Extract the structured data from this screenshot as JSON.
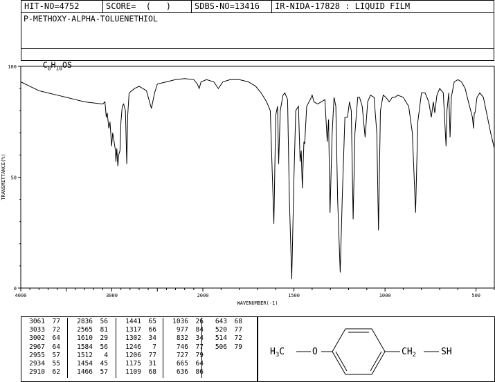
{
  "header": {
    "hit_no": "HIT-NO=4752",
    "score": "SCORE=  (   )",
    "sdbs_no": "SDBS-NO=13416",
    "ir_nida": "IR-NIDA-17828 : LIQUID FILM"
  },
  "compound_name": "P-METHOXY-ALPHA-TOLUENETHIOL",
  "formula": {
    "c": "C",
    "c_sub": "8",
    "h": "H",
    "h_sub": "10",
    "rest": "OS"
  },
  "chart_data": {
    "type": "line",
    "title": "",
    "xlabel": "WAVENUMBER(-1)",
    "ylabel": "TRANSMITTANCE(%)",
    "xlim": [
      4000,
      400
    ],
    "ylim": [
      0,
      100
    ],
    "x_ticks": [
      "4000",
      "3000",
      "2000",
      "1500",
      "1000",
      "500"
    ],
    "y_ticks": [
      "100",
      "50",
      "0"
    ],
    "x_tick_values": [
      4000,
      3000,
      2000,
      1500,
      1000,
      500
    ],
    "y_tick_values": [
      100,
      50,
      0
    ],
    "series": [
      {
        "color": "#000000",
        "points": [
          [
            4000,
            93
          ],
          [
            3900,
            91
          ],
          [
            3800,
            89
          ],
          [
            3700,
            88
          ],
          [
            3600,
            87
          ],
          [
            3500,
            86
          ],
          [
            3400,
            85
          ],
          [
            3300,
            84
          ],
          [
            3200,
            83.5
          ],
          [
            3100,
            83
          ],
          [
            3075,
            84
          ],
          [
            3061,
            77
          ],
          [
            3050,
            79
          ],
          [
            3033,
            72
          ],
          [
            3020,
            75
          ],
          [
            3002,
            64
          ],
          [
            2990,
            70
          ],
          [
            2967,
            64
          ],
          [
            2960,
            62
          ],
          [
            2955,
            57
          ],
          [
            2945,
            63
          ],
          [
            2934,
            55
          ],
          [
            2925,
            60
          ],
          [
            2910,
            62
          ],
          [
            2900,
            75
          ],
          [
            2885,
            82
          ],
          [
            2870,
            83
          ],
          [
            2850,
            80
          ],
          [
            2836,
            56
          ],
          [
            2825,
            78
          ],
          [
            2810,
            88
          ],
          [
            2750,
            90
          ],
          [
            2700,
            91
          ],
          [
            2620,
            89
          ],
          [
            2565,
            81
          ],
          [
            2530,
            88
          ],
          [
            2500,
            92
          ],
          [
            2400,
            93
          ],
          [
            2300,
            94
          ],
          [
            2200,
            94.5
          ],
          [
            2100,
            94
          ],
          [
            2060,
            92
          ],
          [
            2040,
            90
          ],
          [
            2020,
            93
          ],
          [
            1980,
            94
          ],
          [
            1940,
            93
          ],
          [
            1915,
            90
          ],
          [
            1890,
            93
          ],
          [
            1850,
            94
          ],
          [
            1800,
            94
          ],
          [
            1750,
            93
          ],
          [
            1710,
            91
          ],
          [
            1680,
            88
          ],
          [
            1650,
            84
          ],
          [
            1630,
            80
          ],
          [
            1610,
            29
          ],
          [
            1600,
            78
          ],
          [
            1590,
            82
          ],
          [
            1584,
            56
          ],
          [
            1575,
            80
          ],
          [
            1560,
            87
          ],
          [
            1550,
            88
          ],
          [
            1535,
            85
          ],
          [
            1525,
            40
          ],
          [
            1512,
            4
          ],
          [
            1500,
            50
          ],
          [
            1490,
            80
          ],
          [
            1475,
            82
          ],
          [
            1466,
            57
          ],
          [
            1460,
            62
          ],
          [
            1454,
            45
          ],
          [
            1445,
            66
          ],
          [
            1441,
            65
          ],
          [
            1430,
            82
          ],
          [
            1410,
            85
          ],
          [
            1400,
            87
          ],
          [
            1390,
            84
          ],
          [
            1370,
            83
          ],
          [
            1350,
            84
          ],
          [
            1330,
            85
          ],
          [
            1317,
            66
          ],
          [
            1310,
            76
          ],
          [
            1302,
            34
          ],
          [
            1290,
            70
          ],
          [
            1280,
            86
          ],
          [
            1270,
            82
          ],
          [
            1260,
            40
          ],
          [
            1246,
            7
          ],
          [
            1235,
            40
          ],
          [
            1220,
            77
          ],
          [
            1206,
            77
          ],
          [
            1195,
            84
          ],
          [
            1185,
            80
          ],
          [
            1175,
            31
          ],
          [
            1165,
            70
          ],
          [
            1150,
            86
          ],
          [
            1140,
            86
          ],
          [
            1125,
            82
          ],
          [
            1109,
            68
          ],
          [
            1095,
            84
          ],
          [
            1080,
            87
          ],
          [
            1060,
            86
          ],
          [
            1045,
            70
          ],
          [
            1036,
            26
          ],
          [
            1025,
            80
          ],
          [
            1010,
            87
          ],
          [
            995,
            86
          ],
          [
            977,
            84
          ],
          [
            960,
            86
          ],
          [
            945,
            86
          ],
          [
            930,
            87
          ],
          [
            900,
            86
          ],
          [
            870,
            82
          ],
          [
            850,
            70
          ],
          [
            832,
            34
          ],
          [
            820,
            75
          ],
          [
            800,
            88
          ],
          [
            780,
            88
          ],
          [
            760,
            84
          ],
          [
            746,
            77
          ],
          [
            735,
            84
          ],
          [
            727,
            79
          ],
          [
            715,
            87
          ],
          [
            700,
            90
          ],
          [
            680,
            88
          ],
          [
            665,
            64
          ],
          [
            660,
            80
          ],
          [
            650,
            88
          ],
          [
            643,
            68
          ],
          [
            636,
            86
          ],
          [
            620,
            93
          ],
          [
            600,
            94
          ],
          [
            580,
            93
          ],
          [
            560,
            90
          ],
          [
            545,
            85
          ],
          [
            520,
            77
          ],
          [
            514,
            72
          ],
          [
            510,
            79
          ],
          [
            506,
            79
          ],
          [
            495,
            86
          ],
          [
            480,
            88
          ],
          [
            460,
            86
          ],
          [
            440,
            78
          ],
          [
            420,
            70
          ],
          [
            400,
            63
          ]
        ]
      }
    ]
  },
  "peak_table": {
    "columns": [
      {
        "rows": [
          [
            "3061",
            "77"
          ],
          [
            "3033",
            "72"
          ],
          [
            "3002",
            "64"
          ],
          [
            "2967",
            "64"
          ],
          [
            "2955",
            "57"
          ],
          [
            "2934",
            "55"
          ],
          [
            "2910",
            "62"
          ]
        ]
      },
      {
        "rows": [
          [
            "2836",
            "56"
          ],
          [
            "2565",
            "81"
          ],
          [
            "1610",
            "29"
          ],
          [
            "1584",
            "56"
          ],
          [
            "1512",
            "4"
          ],
          [
            "1454",
            "45"
          ],
          [
            "1466",
            "57"
          ]
        ]
      },
      {
        "rows": [
          [
            "1441",
            "65"
          ],
          [
            "1317",
            "66"
          ],
          [
            "1302",
            "34"
          ],
          [
            "1246",
            "7"
          ],
          [
            "1206",
            "77"
          ],
          [
            "1175",
            "31"
          ],
          [
            "1109",
            "68"
          ]
        ]
      },
      {
        "rows": [
          [
            "1036",
            "26"
          ],
          [
            "977",
            "84"
          ],
          [
            "832",
            "34"
          ],
          [
            "746",
            "77"
          ],
          [
            "727",
            "79"
          ],
          [
            "665",
            "64"
          ],
          [
            "636",
            "86"
          ]
        ]
      },
      {
        "rows": [
          [
            "643",
            "68"
          ],
          [
            "520",
            "77"
          ],
          [
            "514",
            "72"
          ],
          [
            "506",
            "79"
          ]
        ]
      }
    ]
  },
  "structure": {
    "left_h": "H",
    "left_sub": "3",
    "left_c": "C",
    "oxygen": "O",
    "ch": "CH",
    "ch_sub": "2",
    "sh": "SH"
  }
}
